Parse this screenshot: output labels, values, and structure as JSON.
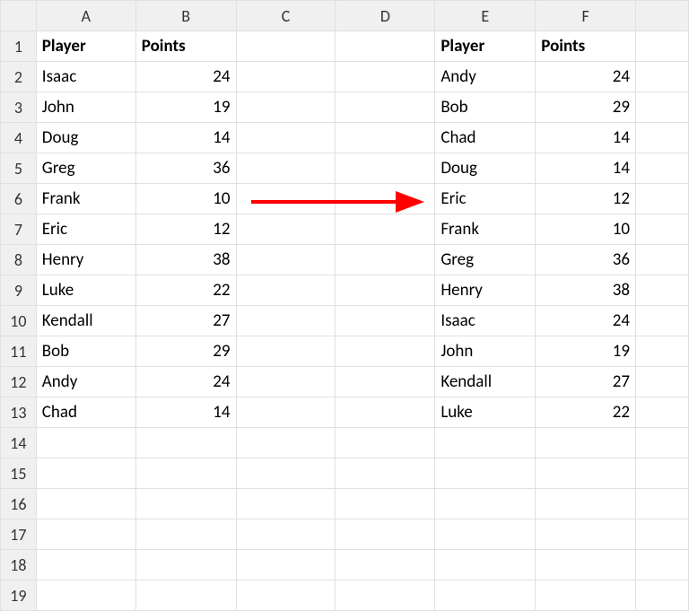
{
  "columns": [
    "A",
    "B",
    "C",
    "D",
    "E",
    "F"
  ],
  "rowCount": 19,
  "headers": {
    "left_player": "Player",
    "left_points": "Points",
    "right_player": "Player",
    "right_points": "Points"
  },
  "leftTable": [
    {
      "player": "Isaac",
      "points": 24
    },
    {
      "player": "John",
      "points": 19
    },
    {
      "player": "Doug",
      "points": 14
    },
    {
      "player": "Greg",
      "points": 36
    },
    {
      "player": "Frank",
      "points": 10
    },
    {
      "player": "Eric",
      "points": 12
    },
    {
      "player": "Henry",
      "points": 38
    },
    {
      "player": "Luke",
      "points": 22
    },
    {
      "player": "Kendall",
      "points": 27
    },
    {
      "player": "Bob",
      "points": 29
    },
    {
      "player": "Andy",
      "points": 24
    },
    {
      "player": "Chad",
      "points": 14
    }
  ],
  "rightTable": [
    {
      "player": "Andy",
      "points": 24
    },
    {
      "player": "Bob",
      "points": 29
    },
    {
      "player": "Chad",
      "points": 14
    },
    {
      "player": "Doug",
      "points": 14
    },
    {
      "player": "Eric",
      "points": 12
    },
    {
      "player": "Frank",
      "points": 10
    },
    {
      "player": "Greg",
      "points": 36
    },
    {
      "player": "Henry",
      "points": 38
    },
    {
      "player": "Isaac",
      "points": 24
    },
    {
      "player": "John",
      "points": 19
    },
    {
      "player": "Kendall",
      "points": 27
    },
    {
      "player": "Luke",
      "points": 22
    }
  ],
  "arrow": {
    "color": "#ff0000"
  }
}
